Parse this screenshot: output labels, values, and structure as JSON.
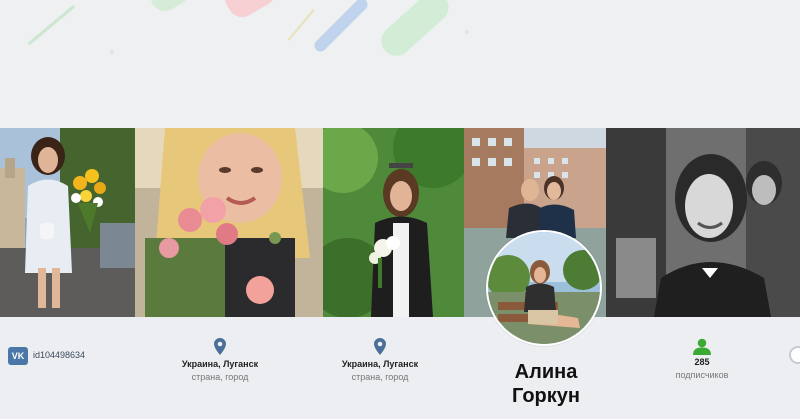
{
  "profile": {
    "vk_badge": "VK",
    "vk_id": "id104498634",
    "locations": [
      {
        "city": "Украина, Луганск",
        "hint": "страна, город"
      },
      {
        "city": "Украина, Луганск",
        "hint": "страна, город"
      }
    ],
    "name_first": "Алина",
    "name_last": "Горкун",
    "subscribers_count": "285",
    "subscribers_label": "подписчиков"
  },
  "colors": {
    "background": "#eceef1",
    "vk_blue": "#4a76a8",
    "pin_blue": "#4c6f9a",
    "subscriber_green": "#3aaa35"
  },
  "icons": {
    "vk": "vk-logo-icon",
    "location": "map-pin-icon",
    "subscribers": "user-icon",
    "next": "circle-arrow-icon"
  }
}
